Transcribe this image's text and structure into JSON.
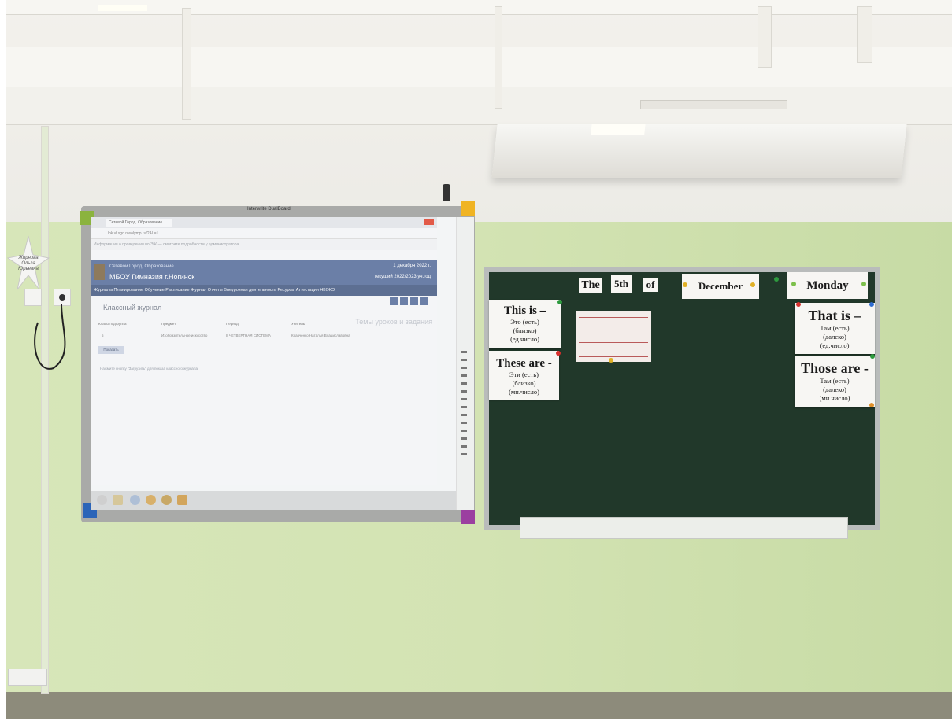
{
  "whiteboard": {
    "brand": "Interwrite DualBoard",
    "screen": {
      "tab_title": "Сетевой Город. Образование",
      "url": "lok.vl.sgo.rosolymp.ru/?AL=1",
      "notice": "Информация о проведении по ЭЖ — смотрите подробности у администратора",
      "header_sub": "Сетевой Город. Образование",
      "header_title": "МБОУ Гимназия г.Ногинск",
      "header_date": "1 декабря 2022 г.",
      "header_user": "текущий 2022/2023 уч.год",
      "nav": "Журналы   Планирование   Обучение   Расписание   Журнал   Отчеты   Внеурочная деятельность   Ресурсы   Аттестация   НКОКО",
      "page_title": "Классный журнал",
      "topics_label": "Темы уроков и задания",
      "fields": [
        {
          "label": "Класс/Подгруппа",
          "value": "5"
        },
        {
          "label": "Предмет",
          "value": "Изобразительное искусство"
        },
        {
          "label": "Период",
          "value": "II ЧЕТВЕРТНАЯ СИСТЕМА"
        },
        {
          "label": "Учитель",
          "value": "Кравченко Наталья Владиславовна"
        }
      ],
      "show_button": "Показать",
      "hint": "Нажмите кнопку \"Загрузить\" для показа классного журнала"
    }
  },
  "chalkboard": {
    "date_words": [
      "The",
      "5th",
      "of",
      "December",
      "Monday"
    ],
    "cards": {
      "this_is": {
        "title": "This is –",
        "lines": [
          "Это (есть)",
          "(близко)",
          "(ед.число)"
        ]
      },
      "these_are": {
        "title": "These are -",
        "lines": [
          "Эти (есть)",
          "(близко)",
          "(мн.число)"
        ]
      },
      "that_is": {
        "title": "That is –",
        "lines": [
          "Там (есть)",
          "(далеко)",
          "(ед.число)"
        ]
      },
      "those_are": {
        "title": "Those are -",
        "lines": [
          "Там (есть)",
          "(далеко)",
          "(мн.число)"
        ]
      }
    }
  },
  "wall": {
    "star_text": "Жирнова Ольга Юрьевна"
  },
  "colors": {
    "wall_green": "#d3e3b3",
    "chalkboard": "#21382a",
    "screen_header": "#6b7fa7"
  }
}
